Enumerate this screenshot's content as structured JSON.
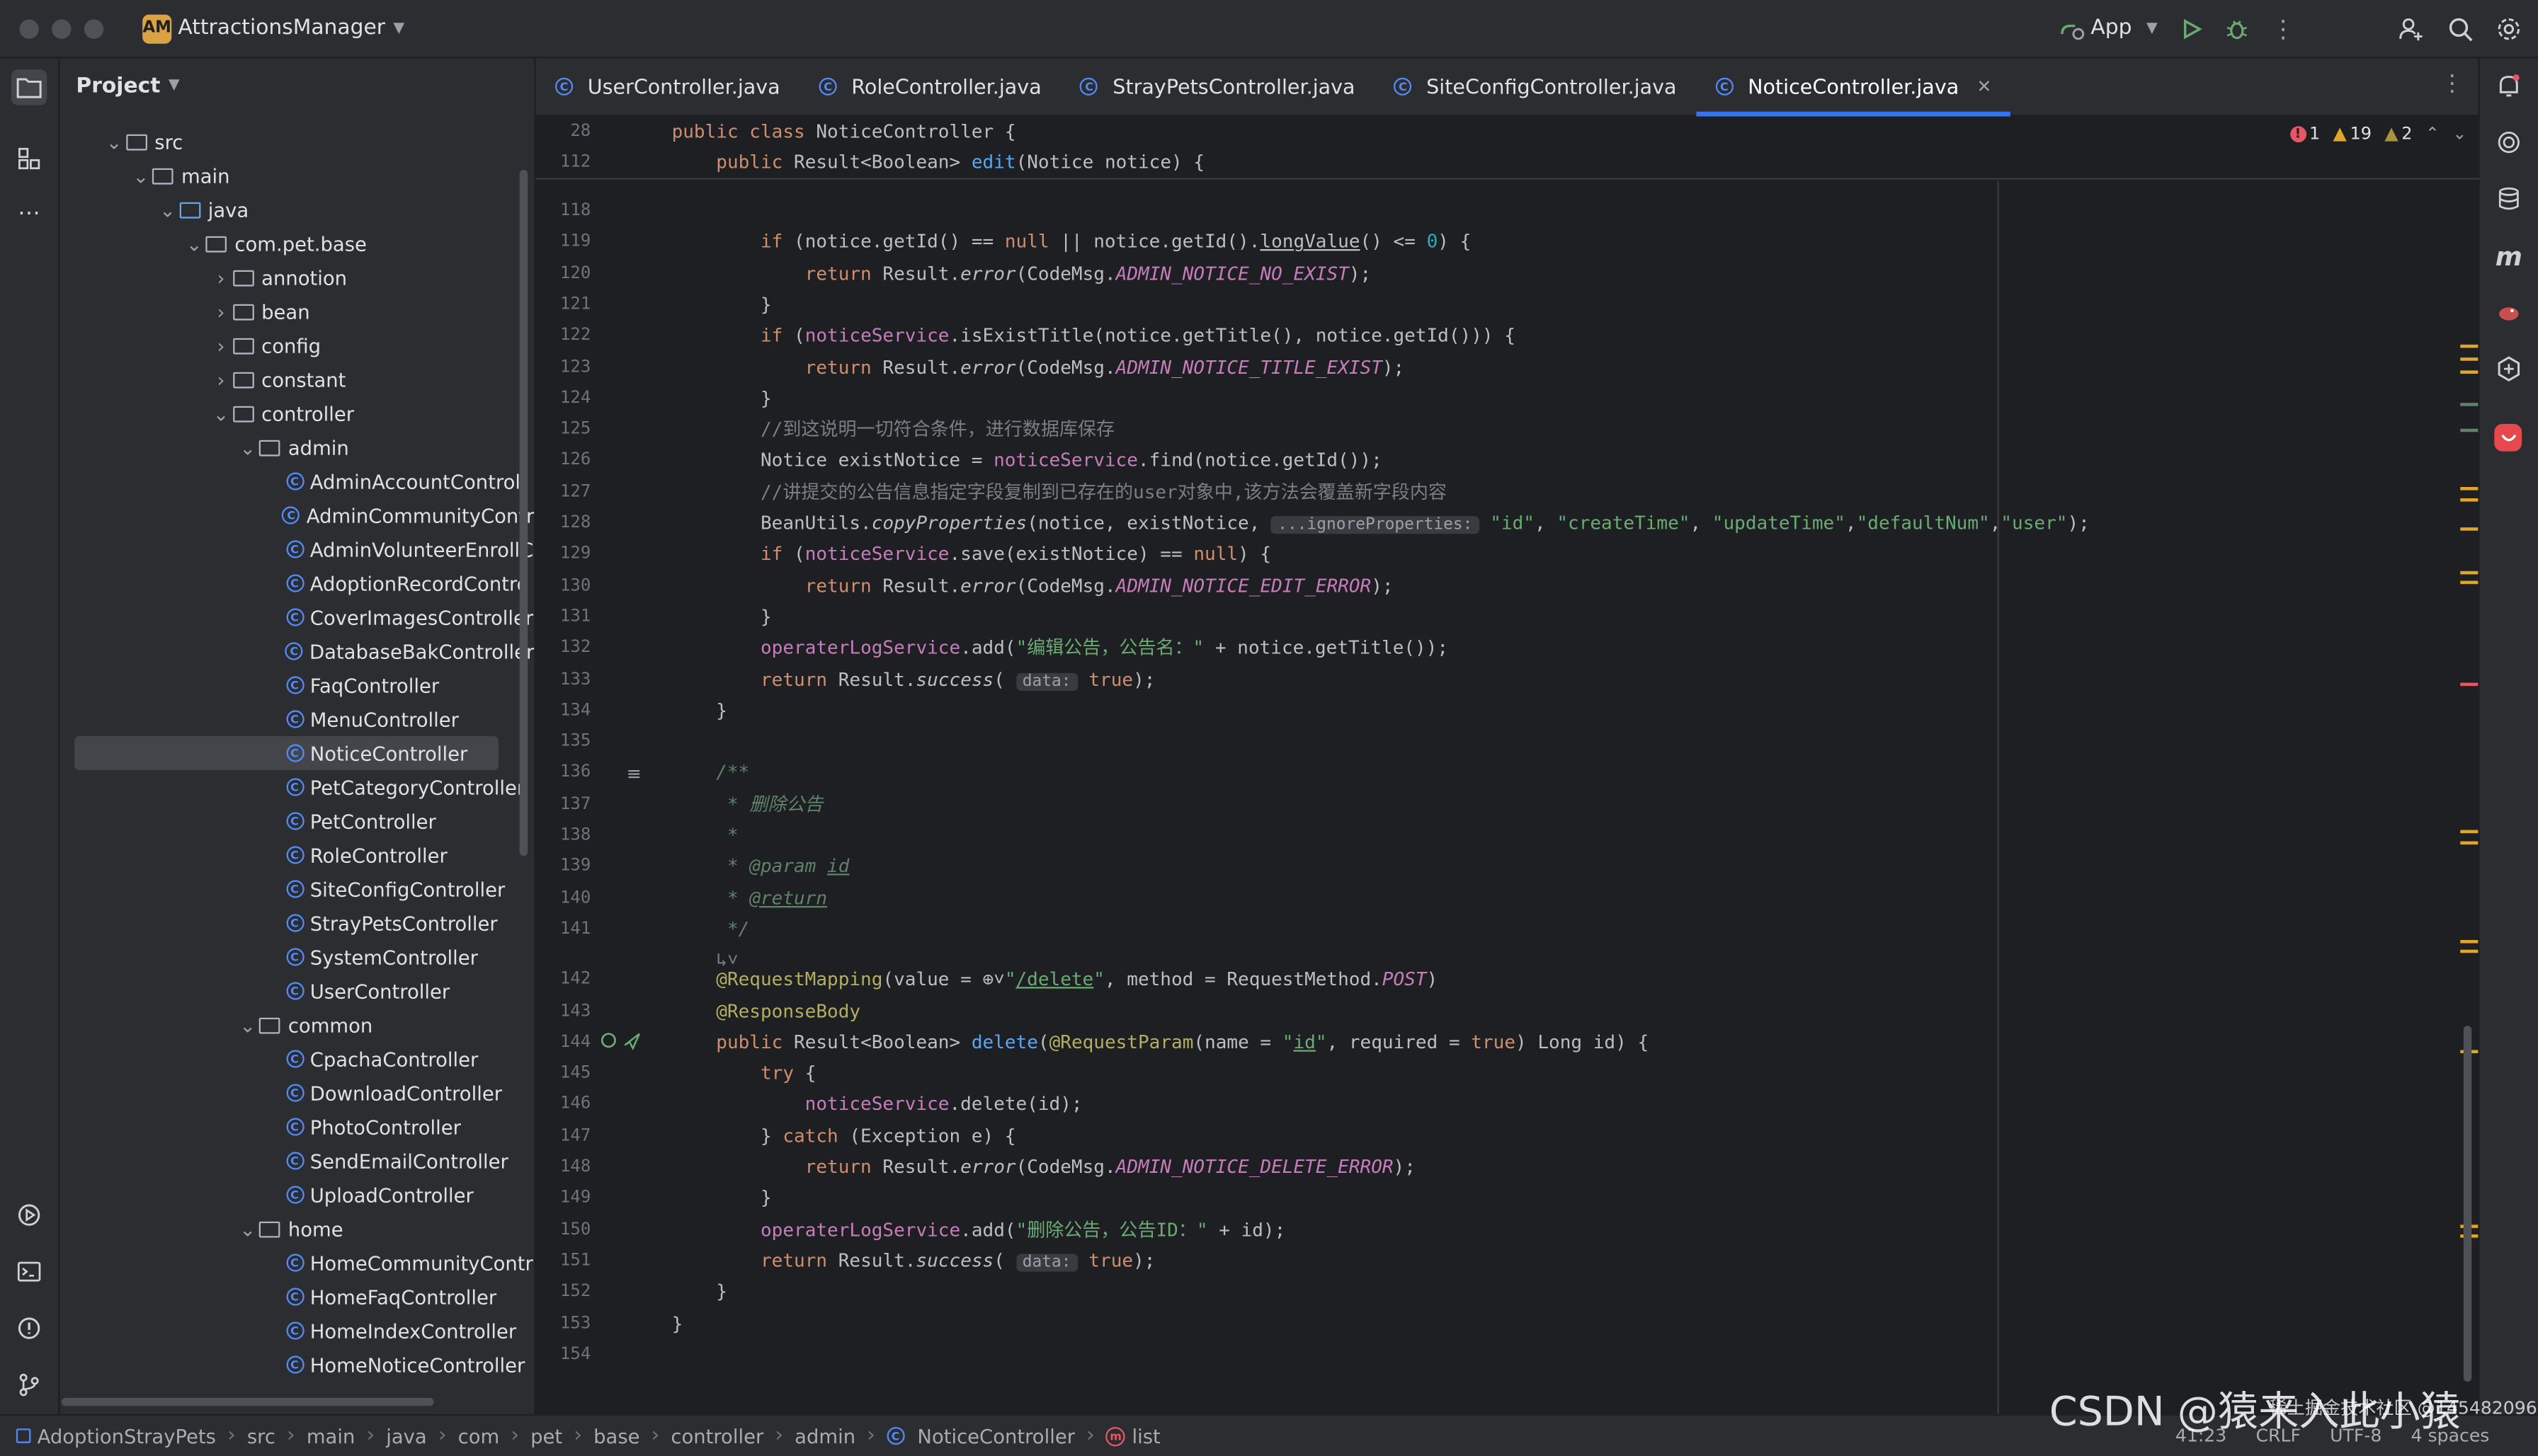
{
  "window": {
    "project_badge": "AM",
    "project_name": "AttractionsManager",
    "run_config": "App"
  },
  "project_panel": {
    "title": "Project",
    "tree": [
      {
        "label": "src",
        "indent": 1,
        "type": "folder",
        "expanded": true
      },
      {
        "label": "main",
        "indent": 2,
        "type": "folder",
        "expanded": true
      },
      {
        "label": "java",
        "indent": 3,
        "type": "java",
        "expanded": true
      },
      {
        "label": "com.pet.base",
        "indent": 4,
        "type": "folder",
        "expanded": true
      },
      {
        "label": "annotion",
        "indent": 5,
        "type": "folder",
        "expanded": false
      },
      {
        "label": "bean",
        "indent": 5,
        "type": "folder",
        "expanded": false
      },
      {
        "label": "config",
        "indent": 5,
        "type": "folder",
        "expanded": false
      },
      {
        "label": "constant",
        "indent": 5,
        "type": "folder",
        "expanded": false
      },
      {
        "label": "controller",
        "indent": 5,
        "type": "folder",
        "expanded": true
      },
      {
        "label": "admin",
        "indent": 6,
        "type": "folder",
        "expanded": true
      },
      {
        "label": "AdminAccountControll",
        "indent": 7,
        "type": "class"
      },
      {
        "label": "AdminCommunityContr",
        "indent": 7,
        "type": "class"
      },
      {
        "label": "AdminVolunteerEnrollC",
        "indent": 7,
        "type": "class"
      },
      {
        "label": "AdoptionRecordContro",
        "indent": 7,
        "type": "class"
      },
      {
        "label": "CoverImagesController",
        "indent": 7,
        "type": "class"
      },
      {
        "label": "DatabaseBakController",
        "indent": 7,
        "type": "class"
      },
      {
        "label": "FaqController",
        "indent": 7,
        "type": "class"
      },
      {
        "label": "MenuController",
        "indent": 7,
        "type": "class"
      },
      {
        "label": "NoticeController",
        "indent": 7,
        "type": "class",
        "selected": true
      },
      {
        "label": "PetCategoryController",
        "indent": 7,
        "type": "class"
      },
      {
        "label": "PetController",
        "indent": 7,
        "type": "class"
      },
      {
        "label": "RoleController",
        "indent": 7,
        "type": "class"
      },
      {
        "label": "SiteConfigController",
        "indent": 7,
        "type": "class"
      },
      {
        "label": "StrayPetsController",
        "indent": 7,
        "type": "class"
      },
      {
        "label": "SystemController",
        "indent": 7,
        "type": "class"
      },
      {
        "label": "UserController",
        "indent": 7,
        "type": "class"
      },
      {
        "label": "common",
        "indent": 6,
        "type": "folder",
        "expanded": true
      },
      {
        "label": "CpachaController",
        "indent": 7,
        "type": "class"
      },
      {
        "label": "DownloadController",
        "indent": 7,
        "type": "class"
      },
      {
        "label": "PhotoController",
        "indent": 7,
        "type": "class"
      },
      {
        "label": "SendEmailController",
        "indent": 7,
        "type": "class"
      },
      {
        "label": "UploadController",
        "indent": 7,
        "type": "class"
      },
      {
        "label": "home",
        "indent": 6,
        "type": "folder",
        "expanded": true
      },
      {
        "label": "HomeCommunityContr",
        "indent": 7,
        "type": "class"
      },
      {
        "label": "HomeFaqController",
        "indent": 7,
        "type": "class"
      },
      {
        "label": "HomeIndexController",
        "indent": 7,
        "type": "class"
      },
      {
        "label": "HomeNoticeController",
        "indent": 7,
        "type": "class"
      }
    ]
  },
  "tabs": [
    {
      "label": "UserController.java",
      "active": false
    },
    {
      "label": "RoleController.java",
      "active": false
    },
    {
      "label": "StrayPetsController.java",
      "active": false
    },
    {
      "label": "SiteConfigController.java",
      "active": false
    },
    {
      "label": "NoticeController.java",
      "active": true
    }
  ],
  "inspections": {
    "errors": "1",
    "warnings": "19",
    "weak_warnings": "2"
  },
  "sticky_lines": [
    {
      "n": "28",
      "html": "<span class='kw'>public class</span> NoticeController {"
    },
    {
      "n": "112",
      "html": "    <span class='kw'>public</span> Result&lt;Boolean&gt; <span class='fn'>edit</span>(Notice notice) {"
    }
  ],
  "code_lines": [
    {
      "n": "118",
      "html": ""
    },
    {
      "n": "119",
      "html": "        <span class='kw'>if</span> (notice.getId() == <span class='kw'>null</span> || notice.getId().<u>longValue</u>() &lt;= <span class='num'>0</span>) {"
    },
    {
      "n": "120",
      "html": "            <span class='kw'>return</span> Result.<span class='it'>error</span>(CodeMsg.<span class='cst'>ADMIN_NOTICE_NO_EXIST</span>);"
    },
    {
      "n": "121",
      "html": "        }"
    },
    {
      "n": "122",
      "html": "        <span class='kw'>if</span> (<span class='fld'>noticeService</span>.isExistTitle(notice.getTitle(), notice.getId())) {"
    },
    {
      "n": "123",
      "html": "            <span class='kw'>return</span> Result.<span class='it'>error</span>(CodeMsg.<span class='cst'>ADMIN_NOTICE_TITLE_EXIST</span>);"
    },
    {
      "n": "124",
      "html": "        }"
    },
    {
      "n": "125",
      "html": "        <span class='cm'>//到这说明一切符合条件，进行数据库保存</span>"
    },
    {
      "n": "126",
      "html": "        Notice existNotice = <span class='fld'>noticeService</span>.find(notice.getId());"
    },
    {
      "n": "127",
      "html": "        <span class='cm'>//讲提交的公告信息指定字段复制到已存在的user对象中,该方法会覆盖新字段内容</span>"
    },
    {
      "n": "128",
      "html": "        BeanUtils.<span class='it'>copyProperties</span>(notice, existNotice, <span class='hint'>...ignoreProperties:</span> <span class='st'>\"id\"</span>, <span class='st'>\"createTime\"</span>, <span class='st'>\"updateTime\"</span>,<span class='st'>\"defaultNum\"</span>,<span class='st'>\"user\"</span>);"
    },
    {
      "n": "129",
      "html": "        <span class='kw'>if</span> (<span class='fld'>noticeService</span>.save(existNotice) == <span class='kw'>null</span>) {"
    },
    {
      "n": "130",
      "html": "            <span class='kw'>return</span> Result.<span class='it'>error</span>(CodeMsg.<span class='cst'>ADMIN_NOTICE_EDIT_ERROR</span>);"
    },
    {
      "n": "131",
      "html": "        }"
    },
    {
      "n": "132",
      "html": "        <span class='fld'>operaterLogService</span>.add(<span class='st'>\"编辑公告，公告名：\"</span> + notice.getTitle());"
    },
    {
      "n": "133",
      "html": "        <span class='kw'>return</span> Result.<span class='it'>success</span>( <span class='hint'>data:</span> <span class='kw'>true</span>);"
    },
    {
      "n": "134",
      "html": "    }"
    },
    {
      "n": "135",
      "html": ""
    },
    {
      "n": "136",
      "html": "    <span class='doc'>/**</span>"
    },
    {
      "n": "137",
      "html": "    <span class='doc'> * 删除公告</span>"
    },
    {
      "n": "138",
      "html": "    <span class='doc'> *</span>"
    },
    {
      "n": "139",
      "html": "    <span class='doc'> * @param <u>id</u></span>"
    },
    {
      "n": "140",
      "html": "    <span class='doc'> * <u>@return</u></span>"
    },
    {
      "n": "141",
      "html": "    <span class='doc'> */</span>"
    },
    {
      "n": "",
      "html": "    <span class='cm'>↳˅</span>"
    },
    {
      "n": "142",
      "html": "    <span class='an'>@RequestMapping</span>(value = ⊕˅<span class='st'>\"<u>/delete</u>\"</span>, method = RequestMethod.<span class='cst'>POST</span>)"
    },
    {
      "n": "143",
      "html": "    <span class='an'>@ResponseBody</span>"
    },
    {
      "n": "144",
      "html": "    <span class='kw'>public</span> Result&lt;Boolean&gt; <span class='fn'>delete</span>(<span class='an'>@RequestParam</span>(name = <span class='st'>\"<u>id</u>\"</span>, required = <span class='kw'>true</span>) Long id) {"
    },
    {
      "n": "145",
      "html": "        <span class='kw'>try</span> {"
    },
    {
      "n": "146",
      "html": "            <span class='fld'>noticeService</span>.delete(id);"
    },
    {
      "n": "147",
      "html": "        } <span class='kw'>catch</span> (Exception e) {"
    },
    {
      "n": "148",
      "html": "            <span class='kw'>return</span> Result.<span class='it'>error</span>(CodeMsg.<span class='cst'>ADMIN_NOTICE_DELETE_ERROR</span>);"
    },
    {
      "n": "149",
      "html": "        }"
    },
    {
      "n": "150",
      "html": "        <span class='fld'>operaterLogService</span>.add(<span class='st'>\"删除公告，公告ID：\"</span> + id);"
    },
    {
      "n": "151",
      "html": "        <span class='kw'>return</span> Result.<span class='it'>success</span>( <span class='hint'>data:</span> <span class='kw'>true</span>);"
    },
    {
      "n": "152",
      "html": "    }"
    },
    {
      "n": "153",
      "html": "}"
    },
    {
      "n": "154",
      "html": ""
    }
  ],
  "breadcrumb": [
    "AdoptionStrayPets",
    "src",
    "main",
    "java",
    "com",
    "pet",
    "base",
    "controller",
    "admin",
    "NoticeController",
    "list"
  ],
  "status_right": {
    "position": "41:23",
    "line_sep": "CRLF",
    "encoding": "UTF-8",
    "indent": "4 spaces"
  },
  "watermark": {
    "main": "CSDN @猿来入此小猿",
    "sub": "稀土掘金技术社区 @1454820960"
  },
  "colors": {
    "accent": "#3574f0",
    "error": "#e55765",
    "warning": "#e0a62a",
    "keyword": "#cf8e6d",
    "string": "#6aab73"
  }
}
